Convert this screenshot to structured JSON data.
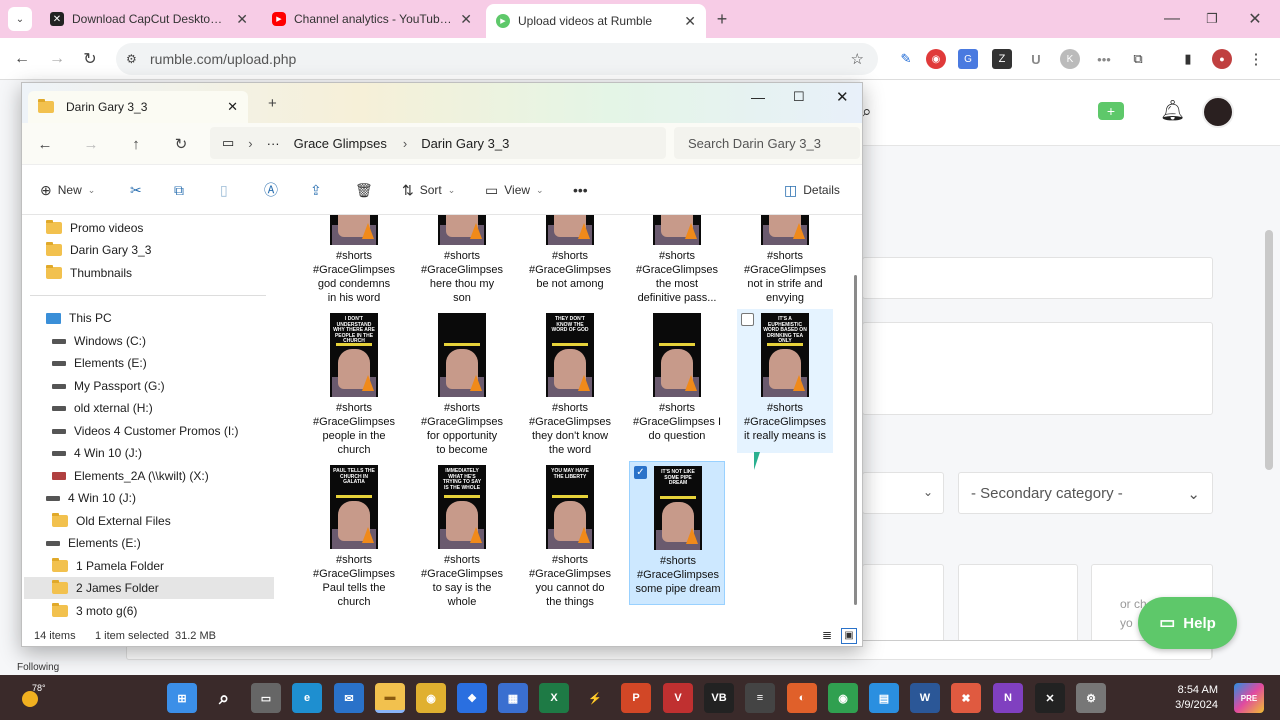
{
  "browser": {
    "tabs": [
      {
        "title": "Download CapCut Desktop - Po",
        "icon": "capcut-icon"
      },
      {
        "title": "Channel analytics - YouTube St",
        "icon": "youtube-icon"
      },
      {
        "title": "Upload videos at Rumble",
        "icon": "rumble-icon"
      }
    ],
    "new_tab": "+",
    "url": "rumble.com/upload.php"
  },
  "explorer": {
    "window_title": "Darin Gary 3_3",
    "breadcrumb": [
      "Grace Glimpses",
      "Darin Gary 3_3"
    ],
    "search_placeholder": "Search Darin Gary 3_3",
    "commands": {
      "new": "New",
      "sort": "Sort",
      "view": "View",
      "details": "Details",
      "more": "•••"
    },
    "nav_items": [
      {
        "label": "Promo videos",
        "icon": "folder-icon",
        "indent": 1
      },
      {
        "label": "Darin Gary 3_3",
        "icon": "folder-icon",
        "indent": 1
      },
      {
        "label": "Thumbnails",
        "icon": "folder-icon",
        "indent": 1
      },
      {
        "label": "This PC",
        "icon": "pc-icon",
        "indent": 0
      },
      {
        "label": "Windows (C:)",
        "icon": "drive-icon",
        "indent": 1
      },
      {
        "label": "Elements (E:)",
        "icon": "drive-icon",
        "indent": 1
      },
      {
        "label": "My Passport (G:)",
        "icon": "drive-icon",
        "indent": 1
      },
      {
        "label": "old xternal (H:)",
        "icon": "drive-icon",
        "indent": 1
      },
      {
        "label": "Videos 4 Customer Promos (I:)",
        "icon": "drive-icon",
        "indent": 1
      },
      {
        "label": "4 Win 10 (J:)",
        "icon": "drive-icon",
        "indent": 1
      },
      {
        "label": "Elements_2A (\\\\kwilt) (X:)",
        "icon": "network-drive-icon",
        "indent": 1
      },
      {
        "label": "4 Win 10 (J:)",
        "icon": "drive-icon",
        "indent": 0
      },
      {
        "label": "Old External Files",
        "icon": "folder-icon",
        "indent": 1
      },
      {
        "label": "Elements (E:)",
        "icon": "drive-icon",
        "indent": 0
      },
      {
        "label": "1 Pamela Folder",
        "icon": "folder-icon",
        "indent": 1
      },
      {
        "label": "2 James Folder",
        "icon": "folder-icon",
        "indent": 1,
        "selected": true
      },
      {
        "label": "3 moto g(6)",
        "icon": "folder-icon",
        "indent": 1
      }
    ],
    "files": [
      {
        "lines": [
          "#shorts",
          "#GraceGlimpses",
          "god condemns",
          "in his word"
        ],
        "caption": ""
      },
      {
        "lines": [
          "#shorts",
          "#GraceGlimpses",
          "here thou my",
          "son"
        ],
        "caption": ""
      },
      {
        "lines": [
          "#shorts",
          "#GraceGlimpses",
          "be not among"
        ],
        "caption": ""
      },
      {
        "lines": [
          "#shorts",
          "#GraceGlimpses",
          "the most",
          "definitive pass..."
        ],
        "caption": ""
      },
      {
        "lines": [
          "#shorts",
          "#GraceGlimpses",
          "not in strife and",
          "envying"
        ],
        "caption": ""
      },
      {
        "lines": [
          "#shorts",
          "#GraceGlimpses",
          "people in the",
          "church"
        ],
        "caption": "I DON'T UNDERSTAND WHY THERE ARE PEOPLE IN THE CHURCH"
      },
      {
        "lines": [
          "#shorts",
          "#GraceGlimpses",
          "for opportunity",
          "to become"
        ],
        "caption": ""
      },
      {
        "lines": [
          "#shorts",
          "#GraceGlimpses",
          "they don't know",
          "the word"
        ],
        "caption": "THEY DON'T KNOW THE WORD OF GOD"
      },
      {
        "lines": [
          "#shorts",
          "#GraceGlimpses I",
          "do question"
        ],
        "caption": ""
      },
      {
        "lines": [
          "#shorts",
          "#GraceGlimpses",
          "it really means is"
        ],
        "caption": "IT'S A EUPHEMISTIC WORD BASED ON DRINKING TEA ONLY",
        "hover": true
      },
      {
        "lines": [
          "#shorts",
          "#GraceGlimpses",
          "Paul tells the",
          "church"
        ],
        "caption": "PAUL TELLS THE CHURCH IN GALATIA"
      },
      {
        "lines": [
          "#shorts",
          "#GraceGlimpses",
          "to say is the",
          "whole"
        ],
        "caption": "IMMEDIATELY WHAT HE'S TRYING TO SAY IS THE WHOLE"
      },
      {
        "lines": [
          "#shorts",
          "#GraceGlimpses",
          "you cannot do",
          "the things"
        ],
        "caption": "YOU MAY HAVE THE LIBERTY"
      },
      {
        "lines": [
          "#shorts",
          "#GraceGlimpses",
          "some pipe dream"
        ],
        "caption": "IT'S NOT LIKE SOME PIPE DREAM",
        "selected": true
      }
    ],
    "status": {
      "count": "14 items",
      "selected": "1 item selected",
      "size": "31.2 MB"
    }
  },
  "rumble": {
    "secondary_category": "- Secondary category -",
    "help_label": "Help",
    "upload_hint": [
      "or ch",
      "yo"
    ],
    "following_label": "Following"
  },
  "taskbar": {
    "weather": "78°",
    "time": "8:54 AM",
    "date": "3/9/2024",
    "apps": [
      "start-icon",
      "search-icon",
      "taskview-icon",
      "edge-icon",
      "mail-icon",
      "file-explorer-icon",
      "chrome-icon",
      "dropbox-icon",
      "store-icon",
      "excel-icon",
      "capcut-icon",
      "powerpoint-icon",
      "voicemeeter-icon",
      "vb-audio-icon",
      "mixer-icon",
      "firefox-icon",
      "chrome-alt-icon",
      "notepad-icon",
      "word-icon",
      "tool-icon",
      "onenote-icon",
      "capcut-alt-icon",
      "settings-icon"
    ]
  },
  "colors": {
    "tab_bg": "#f7cce6",
    "selection": "#cde8ff",
    "help": "#5ec86a",
    "taskbar": "#3a2a2a"
  }
}
